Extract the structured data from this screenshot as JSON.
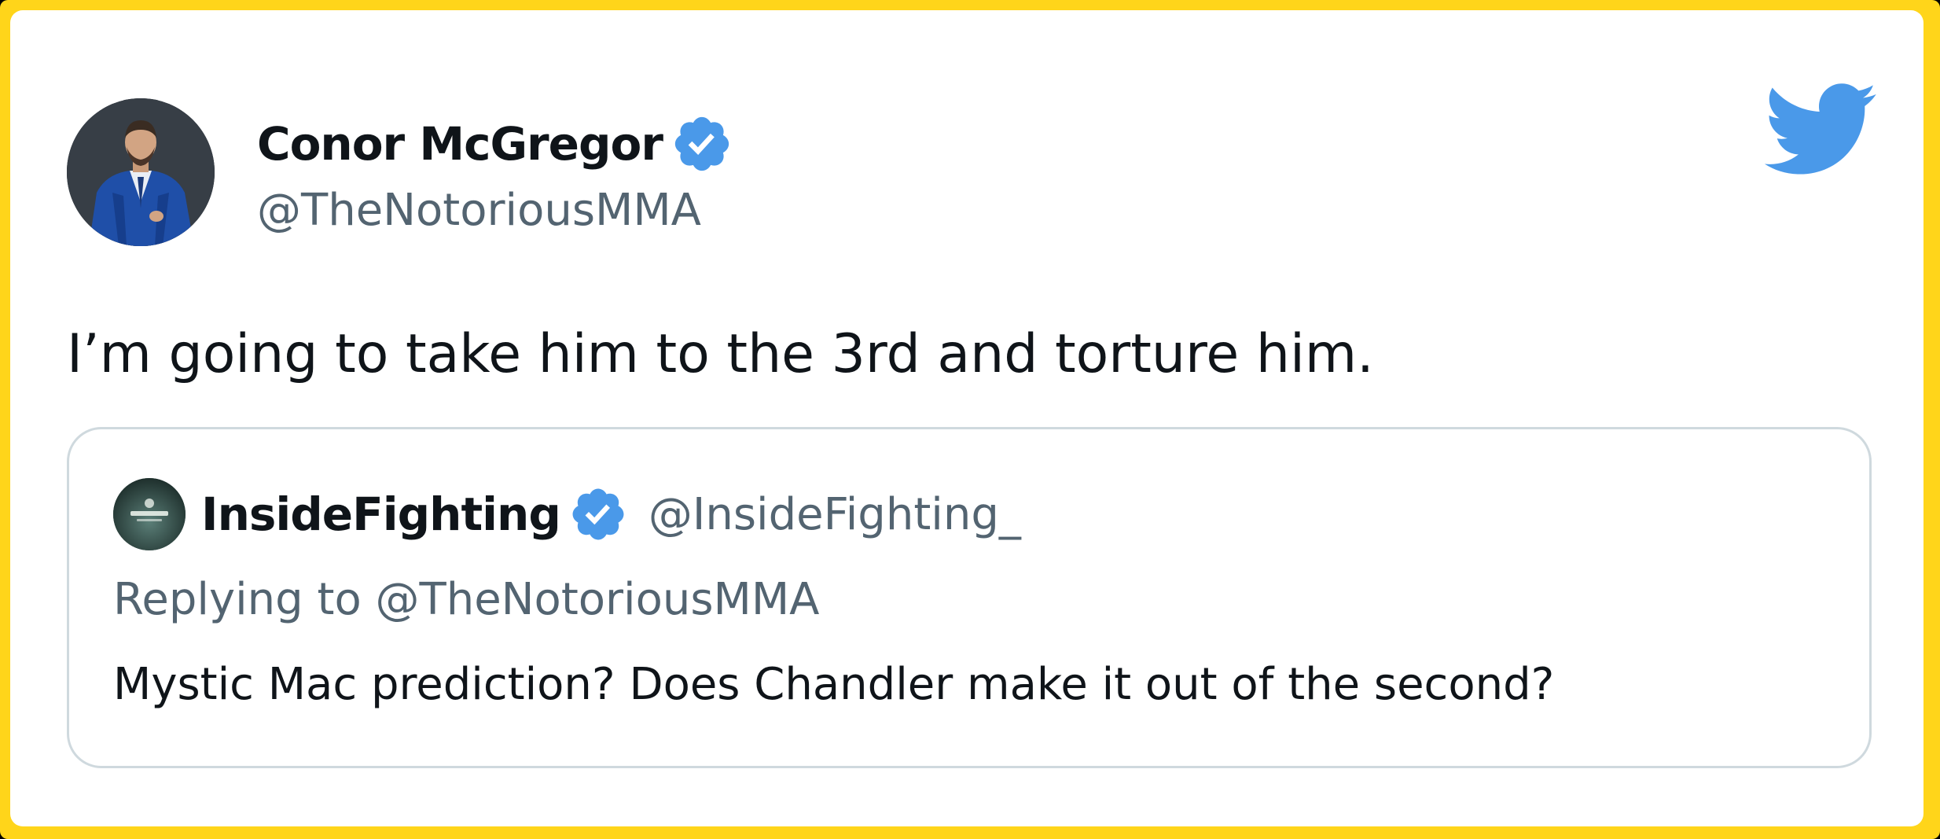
{
  "colors": {
    "frame": "#FFD51A",
    "twitter_blue": "#4A99E9",
    "verified_blue": "#4A99E9",
    "text_primary": "#0f1419",
    "text_secondary": "#536471",
    "quote_border": "#cfd9de"
  },
  "tweet": {
    "author": {
      "name": "Conor McGregor",
      "handle": "@TheNotoriousMMA",
      "verified": true,
      "avatar_icon": "avatar-photo"
    },
    "text": "I’m going to take him to the 3rd and torture him.",
    "logo_icon": "twitter-bird-icon",
    "quoted": {
      "author": {
        "name": "InsideFighting",
        "handle": "@InsideFighting_",
        "verified": true,
        "avatar_icon": "avatar-logo"
      },
      "reply_context": "Replying to @TheNotoriousMMA",
      "text": "Mystic Mac prediction? Does Chandler make it out of the second?"
    }
  }
}
